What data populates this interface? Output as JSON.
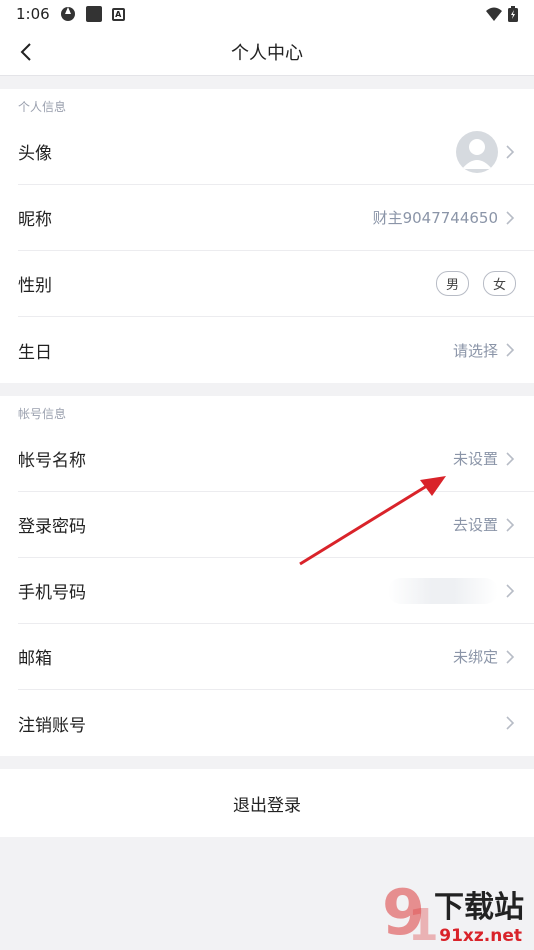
{
  "status": {
    "time": "1:06"
  },
  "nav": {
    "title": "个人中心"
  },
  "personal": {
    "header": "个人信息",
    "avatar_label": "头像",
    "nickname_label": "昵称",
    "nickname_value": "财主9047744650",
    "gender_label": "性别",
    "gender_male": "男",
    "gender_female": "女",
    "birthday_label": "生日",
    "birthday_value": "请选择"
  },
  "account": {
    "header": "帐号信息",
    "account_name_label": "帐号名称",
    "account_name_value": "未设置",
    "password_label": "登录密码",
    "password_value": "去设置",
    "phone_label": "手机号码",
    "email_label": "邮箱",
    "email_value": "未绑定",
    "cancel_label": "注销账号"
  },
  "logout_label": "退出登录",
  "watermark": {
    "text": "下载站",
    "site": "91xz.net"
  },
  "colors": {
    "accent_arrow": "#d9232a",
    "value_gray": "#8b95a8"
  }
}
